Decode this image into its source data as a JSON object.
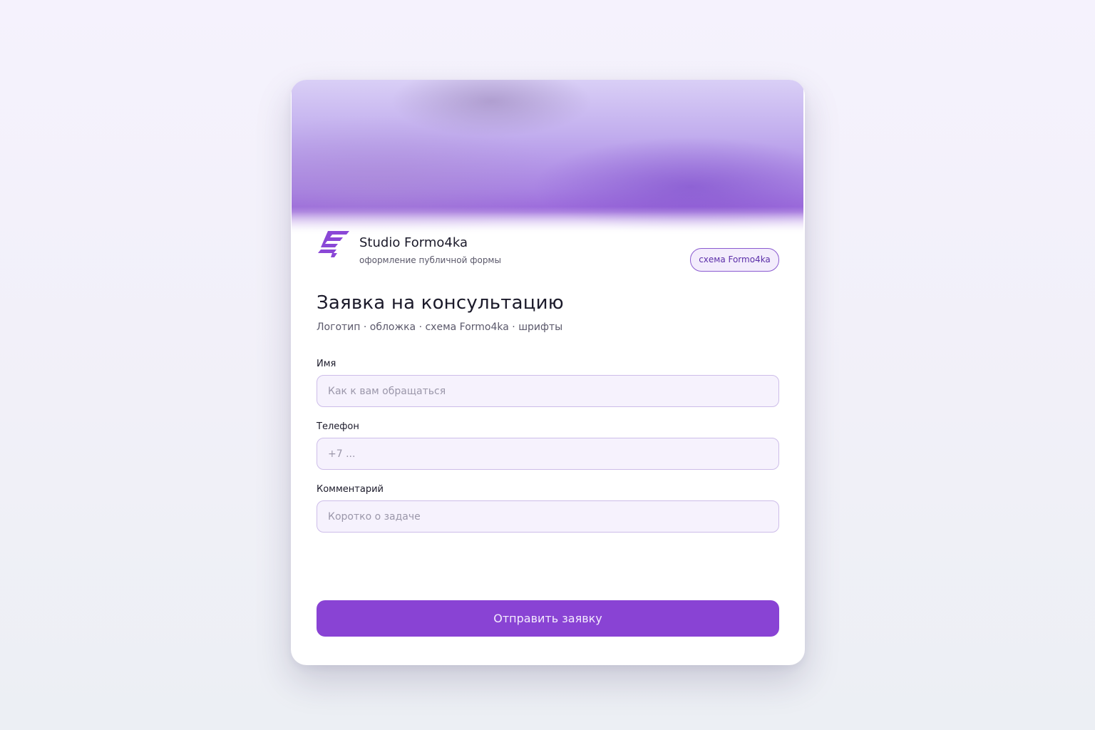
{
  "brand": {
    "logo_icon": "formo4ka-logo-icon",
    "name": "Studio Formo4ka",
    "subtitle": "оформление публичной формы",
    "scheme_badge": "схема Formo4ka"
  },
  "form": {
    "title": "Заявка на консультацию",
    "subtitle": "Логотип · обложка · схема Formo4ka · шрифты",
    "fields": [
      {
        "label": "Имя",
        "placeholder": "Как к вам обращаться",
        "value": ""
      },
      {
        "label": "Телефон",
        "placeholder": "+7 ...",
        "value": ""
      },
      {
        "label": "Комментарий",
        "placeholder": "Коротко о задаче",
        "value": ""
      }
    ],
    "submit_label": "Отправить заявку"
  },
  "colors": {
    "accent": "#8943d4",
    "cover_top": "#d9cff6",
    "cover_bottom": "#9a67da",
    "input_bg": "#f6f2fd",
    "input_border": "#cdbde9"
  }
}
